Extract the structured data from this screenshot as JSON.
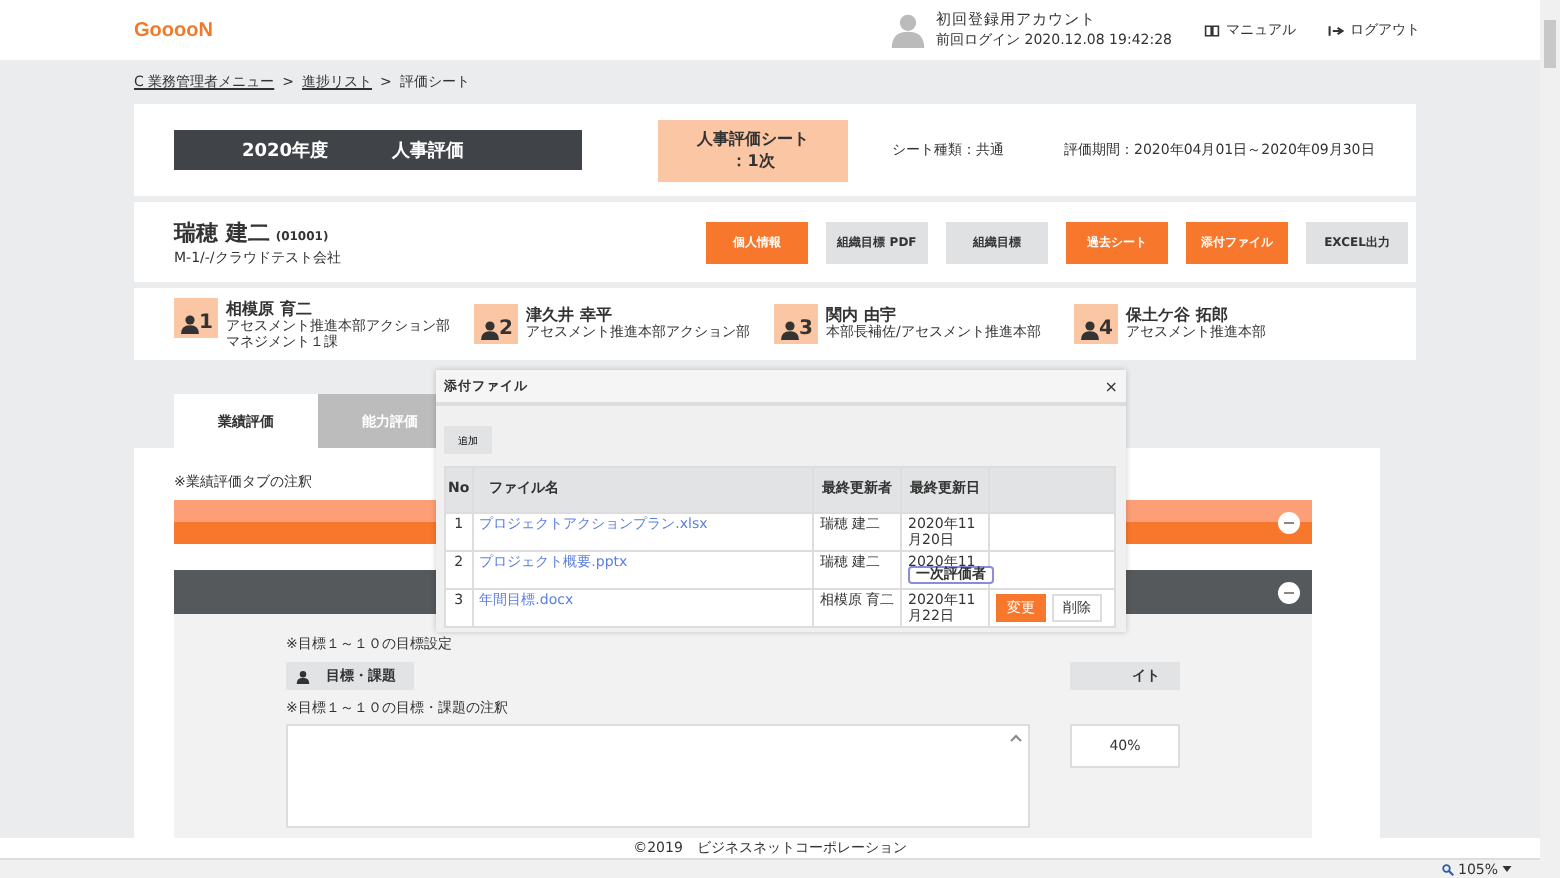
{
  "header": {
    "logo": "GooooN",
    "account_name": "初回登録用アカウント",
    "last_login": "前回ログイン 2020.12.08 19:42:28",
    "links": [
      {
        "label": "マニュアル",
        "kind": "book"
      },
      {
        "label": "ログアウト",
        "kind": "logout"
      }
    ]
  },
  "breadcrumb": [
    {
      "label": "C 業務管理者メニュー",
      "link": true
    },
    {
      "label": ">",
      "link": false
    },
    {
      "label": "進捗リスト",
      "link": true
    },
    {
      "label": ">",
      "link": false
    },
    {
      "label": "評価シート",
      "link": false
    }
  ],
  "sheet": {
    "title_year": "2020年度",
    "title": "人事評価",
    "sheet_name": [
      "人事評価シート",
      "：1次"
    ],
    "sheet_type": "シート種類：共通",
    "period": "評価期間：2020年04月01日～2020年09月30日"
  },
  "person": {
    "name": "瑞穂 建二",
    "code": "(01001)",
    "org": "M-1/-/クラウドテスト会社",
    "buttons": [
      {
        "label": "個人情報",
        "primary": true
      },
      {
        "label": "組織目標 PDF",
        "primary": false
      },
      {
        "label": "組織目標",
        "primary": false
      },
      {
        "label": "過去シート",
        "primary": true
      },
      {
        "label": "添付ファイル",
        "primary": true
      },
      {
        "label": "EXCEL出力",
        "primary": false
      }
    ]
  },
  "evaluators": [
    {
      "number": "1",
      "name": "相模原 育二",
      "dept": "アセスメント推進本部アクション部マネジメント１課"
    },
    {
      "number": "2",
      "name": "津久井 幸平",
      "dept": "アセスメント推進本部アクション部"
    },
    {
      "number": "3",
      "name": "関内 由宇",
      "dept": "本部長補佐/アセスメント推進本部"
    },
    {
      "number": "4",
      "name": "保土ケ谷 拓郎",
      "dept": "アセスメント推進本部"
    }
  ],
  "tabs": [
    {
      "label": "業績評価",
      "selected": true
    },
    {
      "label": "能力評価",
      "selected": false
    }
  ],
  "content": {
    "tab_note": "※業績評価タブの注釈",
    "goal_setting_note": "※目標１～１０の目標設定",
    "goal_button": "目標・課題",
    "weight_header": "イト",
    "goal_note": "※目標１～１０の目標・課題の注釈",
    "weight_value": "40%"
  },
  "modal": {
    "title": "添付ファイル",
    "close": "×",
    "add_button": "追加",
    "columns": [
      "No",
      "ファイル名",
      "最終更新者",
      "最終更新日"
    ],
    "rows": [
      {
        "no": "1",
        "file": "プロジェクトアクションプラン.xlsx",
        "updater": "瑞穂 建二",
        "date": "2020年11月20日",
        "actions": []
      },
      {
        "no": "2",
        "file": "プロジェクト概要.pptx",
        "updater": "瑞穂 建二",
        "date": "2020年11",
        "actions": []
      },
      {
        "no": "3",
        "file": "年間目標.docx",
        "updater": "相模原 育二",
        "date": "2020年11月22日",
        "actions": [
          {
            "label": "変更",
            "primary": true
          },
          {
            "label": "削除",
            "primary": false
          }
        ]
      }
    ],
    "tooltip": "一次評価者"
  },
  "footer": "©2019　ビジネスネットコーポレーション",
  "zoom": "105%"
}
